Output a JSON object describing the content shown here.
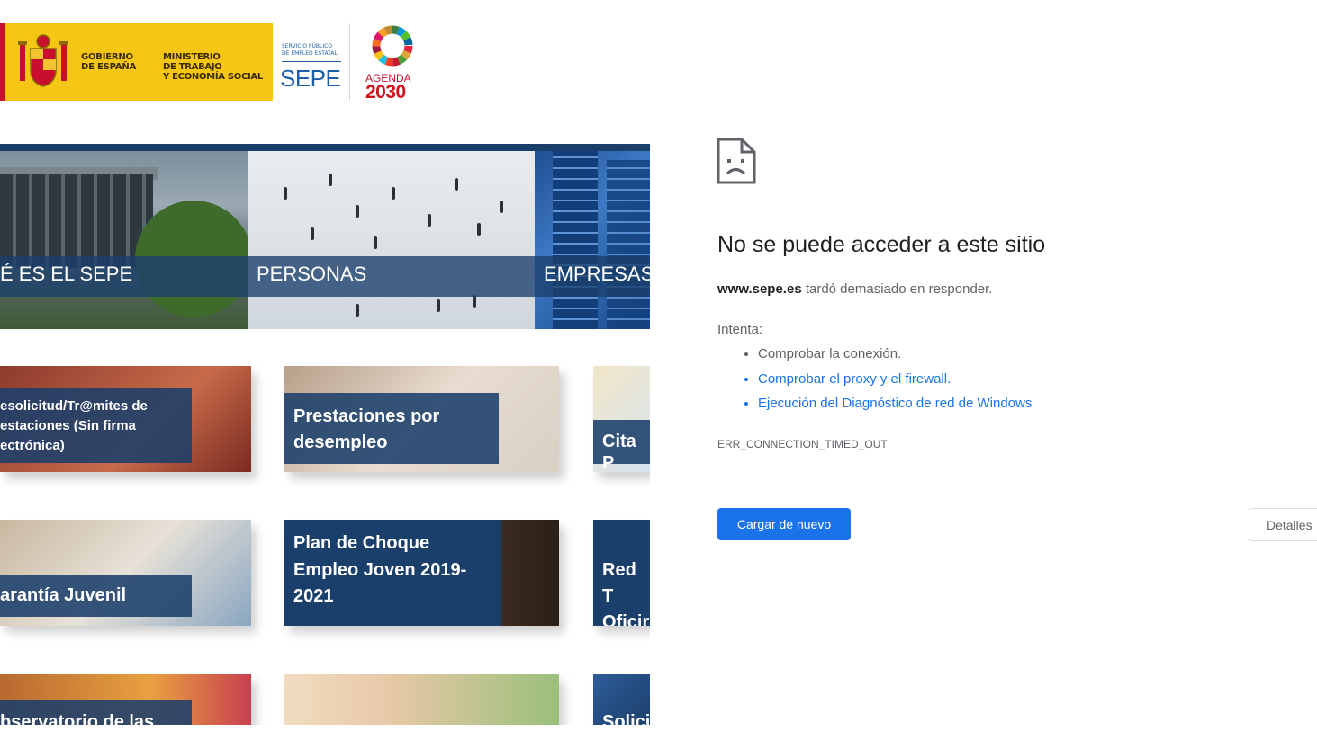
{
  "logos": {
    "gobierno": "GOBIERNO\nDE ESPAÑA",
    "ministerio": "MINISTERIO\nDE TRABAJO\nY ECONOMÍA SOCIAL",
    "sepe_sub": "SERVICIO PÚBLICO\nDE EMPLEO ESTATAL",
    "sepe": "SEPE",
    "agenda": "AGENDA",
    "agenda_year": "2030"
  },
  "hero": {
    "items": [
      {
        "label": "É ES EL SEPE"
      },
      {
        "label": "PERSONAS"
      },
      {
        "label": "EMPRESAS"
      }
    ]
  },
  "cards": [
    {
      "label": "esolicitud/Tr@mites de\nestaciones (Sin firma\nectrónica)"
    },
    {
      "label": "Prestaciones por\ndesempleo"
    },
    {
      "label": "Cita P"
    },
    {
      "label": "arantía Juvenil"
    },
    {
      "label": "Plan de Choque\nEmpleo Joven 2019-\n2021"
    },
    {
      "label": "Red T\nOficir"
    },
    {
      "label": "bservatorio de las"
    },
    {
      "label": ""
    },
    {
      "label": "Solici"
    }
  ],
  "error": {
    "title": "No se puede acceder a este sitio",
    "host": "www.sepe.es",
    "message": " tardó demasiado en responder.",
    "try_label": "Intenta:",
    "suggestions": [
      "Comprobar la conexión.",
      "Comprobar el proxy y el firewall.",
      "Ejecución del Diagnóstico de red de Windows"
    ],
    "code": "ERR_CONNECTION_TIMED_OUT",
    "reload_button": "Cargar de nuevo",
    "details_button": "Detalles"
  },
  "colors": {
    "banner_yellow": "#f6c614",
    "sepe_navy": "#1b3f6b",
    "chrome_blue": "#1a73e8"
  }
}
